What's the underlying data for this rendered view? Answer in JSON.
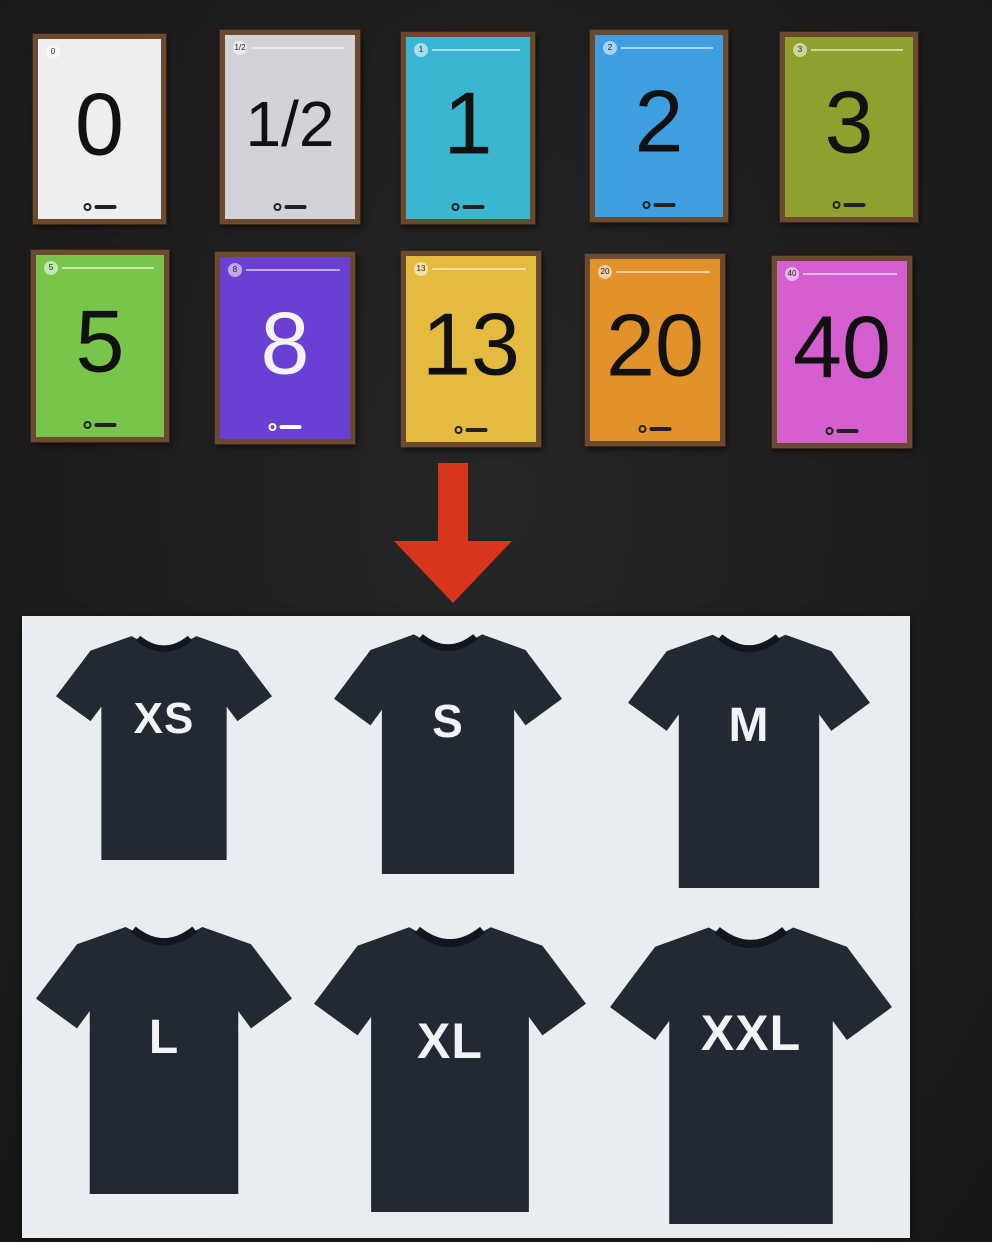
{
  "colors": {
    "background": "#1e1e1f",
    "arrow": "#d8351d",
    "panel": "#e9ecf0",
    "shirt": "#222933",
    "card_border": "#6b4a2f"
  },
  "cards": [
    {
      "value": "0",
      "color": "#eeeeee"
    },
    {
      "value": "1/2",
      "color": "#d2d3d8"
    },
    {
      "value": "1",
      "color": "#3ab6d1"
    },
    {
      "value": "2",
      "color": "#3f9ee0"
    },
    {
      "value": "3",
      "color": "#8fa02f"
    },
    {
      "value": "5",
      "color": "#79c44b"
    },
    {
      "value": "8",
      "color": "#6a3fd3"
    },
    {
      "value": "13",
      "color": "#e5bb3f"
    },
    {
      "value": "20",
      "color": "#e1922b"
    },
    {
      "value": "40",
      "color": "#d65fd0"
    }
  ],
  "arrow_icon": "arrow-down-icon",
  "shirts": [
    {
      "size": "XS"
    },
    {
      "size": "S"
    },
    {
      "size": "M"
    },
    {
      "size": "L"
    },
    {
      "size": "XL"
    },
    {
      "size": "XXL"
    }
  ]
}
